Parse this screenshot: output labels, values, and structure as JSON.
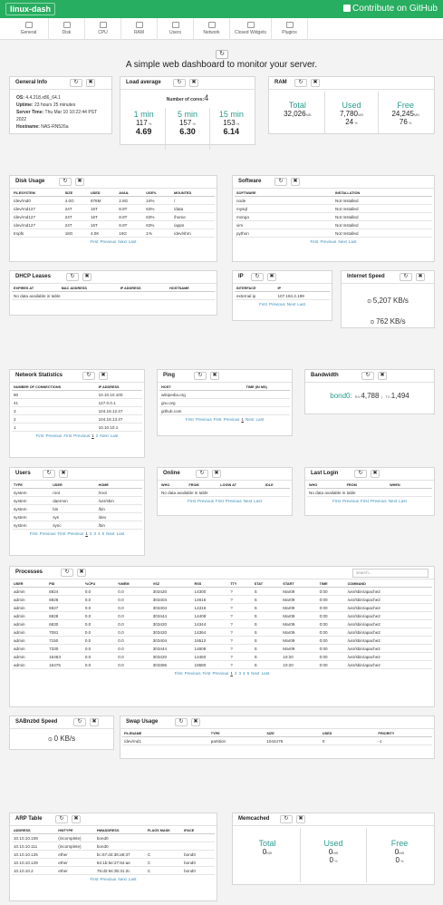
{
  "brand": "linux-dash",
  "github_link": "Contribute on GitHub",
  "nav": [
    "General",
    "Disk",
    "CPU",
    "RAM",
    "Users",
    "Network",
    "Closed Widgets",
    "Plugins"
  ],
  "subtitle": "A simple web dashboard to monitor your server.",
  "general_info": {
    "title": "General Info",
    "os_label": "OS:",
    "os": "4.4.218.x86_64.1",
    "uptime_label": "Uptime:",
    "uptime": "23 hours 25 minutes",
    "time_label": "Server Time:",
    "time": "Thu Mar 10 10:22:44 PST 2022",
    "host_label": "Hostname:",
    "host": "NAS-RN526a"
  },
  "load": {
    "title": "Load average",
    "cores_label": "Number of cores:",
    "cores": "4",
    "cols": [
      {
        "label": "1 min",
        "pct": "117",
        "val": "4.69"
      },
      {
        "label": "5 min",
        "pct": "157",
        "val": "6.30"
      },
      {
        "label": "15 min",
        "pct": "153",
        "val": "6.14"
      }
    ]
  },
  "ram": {
    "title": "RAM",
    "cols": [
      {
        "label": "Total",
        "val": "32,026",
        "unit": "MB",
        "pct": ""
      },
      {
        "label": "Used",
        "val": "7,780",
        "unit": "MB",
        "pct": "24"
      },
      {
        "label": "Free",
        "val": "24,245",
        "unit": "MB",
        "pct": "76"
      }
    ]
  },
  "disk": {
    "title": "Disk Usage",
    "headers": [
      "FILESYSTEM",
      "SIZE",
      "USED",
      "AVAIL",
      "USE%",
      "MOUNTED"
    ],
    "rows": [
      [
        "/dev/md0",
        "4.0G",
        "878M",
        "2.8G",
        "24%",
        "/"
      ],
      [
        "/dev/md127",
        "24T",
        "15T",
        "8.8T",
        "63%",
        "/data"
      ],
      [
        "/dev/md127",
        "24T",
        "15T",
        "8.8T",
        "63%",
        "/home"
      ],
      [
        "/dev/md127",
        "24T",
        "15T",
        "8.8T",
        "63%",
        "/apps"
      ],
      [
        "tmpfs",
        "16G",
        "4.0K",
        "16G",
        "1%",
        "/dev/shm"
      ]
    ]
  },
  "software": {
    "title": "Software",
    "headers": [
      "SOFTWARE",
      "INSTALLATION"
    ],
    "rows": [
      [
        "node",
        "Not Installed"
      ],
      [
        "mysql",
        "Not Installed"
      ],
      [
        "mongo",
        "Not Installed"
      ],
      [
        "vim",
        "Not Installed"
      ],
      [
        "python",
        "Not Installed"
      ]
    ]
  },
  "dhcp": {
    "title": "DHCP Leases",
    "headers": [
      "EXPIRES AT",
      "MAC ADDRESS",
      "IP ADDRESS",
      "HOSTNAME"
    ],
    "empty": "No data available in table"
  },
  "ip": {
    "title": "IP",
    "headers": [
      "INTERFACE",
      "IP"
    ],
    "rows": [
      [
        "external ip",
        "107.184.2.199"
      ]
    ]
  },
  "speed": {
    "title": "Internet Speed",
    "down": "5,207 KB/s",
    "up": "762 KB/s"
  },
  "netstat": {
    "title": "Network Statistics",
    "headers": [
      "NUMBER OF CONNECTIONS",
      "IP ADDRESS"
    ],
    "rows": [
      [
        "80",
        "10.10.10.100"
      ],
      [
        "41",
        "127.0.0.1"
      ],
      [
        "3",
        "104.18.12.47"
      ],
      [
        "2",
        "104.18.13.47"
      ],
      [
        "1",
        "10.10.10.1"
      ]
    ]
  },
  "ping": {
    "title": "Ping",
    "headers": [
      "HOST",
      "TIME (IN MS)"
    ],
    "rows": [
      [
        "wikipedia.org",
        ""
      ],
      [
        "gnu.org",
        ""
      ],
      [
        "github.com",
        ""
      ]
    ]
  },
  "bandwidth": {
    "title": "Bandwidth",
    "iface": "bond0:",
    "rx_label": "RX:",
    "rx": "4,788",
    "tx_label": "TX:",
    "tx": "1,494"
  },
  "users": {
    "title": "Users",
    "headers": [
      "TYPE",
      "USER",
      "HOME"
    ],
    "rows": [
      [
        "system",
        "root",
        "/root"
      ],
      [
        "system",
        "daemon",
        "/usr/sbin"
      ],
      [
        "system",
        "bin",
        "/bin"
      ],
      [
        "system",
        "sys",
        "/dev"
      ],
      [
        "system",
        "sync",
        "/bin"
      ]
    ]
  },
  "online": {
    "title": "Online",
    "headers": [
      "WHO",
      "FROM",
      "LOGIN AT",
      "IDLE"
    ],
    "empty": "No data available in table"
  },
  "lastlogin": {
    "title": "Last Login",
    "headers": [
      "WHO",
      "FROM",
      "WHEN"
    ],
    "empty": "No data available in table"
  },
  "processes": {
    "title": "Processes",
    "search": "search...",
    "headers": [
      "USER",
      "PID",
      "%CPU",
      "%MEM",
      "VSZ",
      "RSS",
      "TTY",
      "STAT",
      "START",
      "TIME",
      "COMMAND"
    ],
    "rows": [
      [
        "admin",
        "6824",
        "0.0",
        "0.0",
        "303420",
        "14300",
        "?",
        "S",
        "Mar09",
        "0:00",
        "/usr/sbin/apache2"
      ],
      [
        "admin",
        "6826",
        "0.0",
        "0.0",
        "303404",
        "14616",
        "?",
        "S",
        "Mar09",
        "0:00",
        "/usr/sbin/apache2"
      ],
      [
        "admin",
        "6827",
        "0.0",
        "0.0",
        "303404",
        "14316",
        "?",
        "S",
        "Mar09",
        "0:00",
        "/usr/sbin/apache2"
      ],
      [
        "admin",
        "6828",
        "0.0",
        "0.0",
        "303444",
        "14408",
        "?",
        "S",
        "Mar09",
        "0:00",
        "/usr/sbin/apache2"
      ],
      [
        "admin",
        "6830",
        "0.0",
        "0.0",
        "303420",
        "14344",
        "?",
        "S",
        "Mar09",
        "0:00",
        "/usr/sbin/apache2"
      ],
      [
        "admin",
        "7081",
        "0.0",
        "0.0",
        "303420",
        "14364",
        "?",
        "S",
        "Mar09",
        "0:00",
        "/usr/sbin/apache2"
      ],
      [
        "admin",
        "7150",
        "0.0",
        "0.0",
        "303404",
        "16512",
        "?",
        "S",
        "Mar09",
        "0:00",
        "/usr/sbin/apache2"
      ],
      [
        "admin",
        "7330",
        "0.0",
        "0.0",
        "303444",
        "14608",
        "?",
        "S",
        "Mar09",
        "0:00",
        "/usr/sbin/apache2"
      ],
      [
        "admin",
        "16463",
        "0.0",
        "0.0",
        "303420",
        "14460",
        "?",
        "S",
        "10:20",
        "0:00",
        "/usr/sbin/apache2"
      ],
      [
        "admin",
        "16475",
        "0.0",
        "0.0",
        "303396",
        "16580",
        "?",
        "S",
        "10:20",
        "0:00",
        "/usr/sbin/apache2"
      ]
    ]
  },
  "sabnzbd": {
    "title": "SABnzbd Speed",
    "val": "0 KB/s"
  },
  "swap": {
    "title": "Swap Usage",
    "headers": [
      "FILENAME",
      "TYPE",
      "SIZE",
      "USED",
      "PRIORITY"
    ],
    "rows": [
      [
        "/dev/md1",
        "partition",
        "1044476",
        "0",
        "-1"
      ]
    ]
  },
  "arp": {
    "title": "ARP Table",
    "headers": [
      "ADDRESS",
      "HWTYPE",
      "HWADDRESS",
      "FLAGS MASK",
      "IFACE"
    ],
    "rows": [
      [
        "10.10.10.109",
        "(incomplete)",
        "bond0",
        "",
        ""
      ],
      [
        "10.10.10.111",
        "(incomplete)",
        "bond0",
        "",
        ""
      ],
      [
        "10.10.10.125",
        "ether",
        "bc:67:d4:36:a9:37",
        "C",
        "bond0"
      ],
      [
        "10.10.10.129",
        "ether",
        "84:1b:5e:27:64:ae",
        "C",
        "bond0"
      ],
      [
        "10.10.10.2",
        "ether",
        "78:d2:94:3b:31:2c",
        "C",
        "bond0"
      ]
    ]
  },
  "memcached": {
    "title": "Memcached",
    "cols": [
      {
        "label": "Total",
        "val": "0",
        "unit": "MB",
        "pct": ""
      },
      {
        "label": "Used",
        "val": "0",
        "unit": "MB",
        "pct": "0"
      },
      {
        "label": "Free",
        "val": "0",
        "unit": "MB",
        "pct": "0"
      }
    ]
  },
  "pg": {
    "first": "First",
    "prev": "Previous",
    "next": "Next",
    "last": "Last",
    "p1": "1",
    "p2": "2",
    "p3": "3",
    "p4": "4",
    "p5": "5"
  },
  "icons": {
    "refresh": "↻",
    "close": "✖"
  }
}
